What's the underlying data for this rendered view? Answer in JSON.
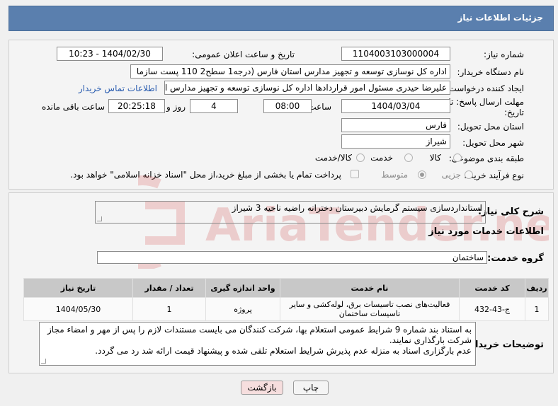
{
  "header": {
    "title": "جزئیات اطلاعات نیاز"
  },
  "fields": {
    "need_number_label": "شماره نیاز:",
    "need_number": "1104003103000004",
    "announce_label": "تاریخ و ساعت اعلان عمومی:",
    "announce_value": "1404/02/30 - 10:23",
    "buyer_label": "نام دستگاه خریدار:",
    "buyer_value": "اداره کل نوسازی   توسعه و تجهیز مدارس استان فارس (درجه1  سطح2  110 پست سازما",
    "creator_label": "ایجاد کننده درخواست:",
    "creator_value": "علیرضا حیدری مسئول امور قراردادها اداره کل نوسازی   توسعه و تجهیز مدارس ا",
    "contact_link": "اطلاعات تماس خریدار",
    "deadline_label": "مهلت ارسال پاسخ: تا",
    "deadline_label2": "تاریخ:",
    "deadline_date": "1404/03/04",
    "time_label": "ساعت",
    "deadline_time": "08:00",
    "days_value": "4",
    "days_label": "روز و",
    "remaining_time": "20:25:18",
    "remaining_label": "ساعت باقی مانده",
    "province_label": "استان محل تحویل:",
    "province_value": "فارس",
    "city_label": "شهر محل تحویل:",
    "city_value": "شیراز",
    "category_label": "طبقه بندی موضوعی:",
    "category_options": [
      "کالا",
      "خدمت",
      "کالا/خدمت"
    ],
    "process_label": "نوع فرآیند خرید :",
    "process_options": [
      "جزیی",
      "متوسط"
    ],
    "payment_note": "پرداخت تمام یا بخشی از مبلغ خرید،از محل \"اسناد خزانه اسلامی\" خواهد بود."
  },
  "summary": {
    "label": "شرح کلی نیاز:",
    "value": "استانداردسازی سیستم گرمایش دبیرستان دخترانه راضیه ناحیه 3 شیراز"
  },
  "services": {
    "heading": "اطلاعات خدمات مورد نیاز",
    "group_label": "گروه خدمت:",
    "group_value": "ساختمان",
    "columns": [
      "ردیف",
      "کد خدمت",
      "نام خدمت",
      "واحد اندازه گیری",
      "تعداد / مقدار",
      "تاریخ نیاز"
    ],
    "rows": [
      [
        "1",
        "ج-43-432",
        "فعالیت‌های نصب تاسیسات برق، لوله‌کشی و سایر تاسیسات ساختمان",
        "پروژه",
        "1",
        "1404/05/30"
      ]
    ]
  },
  "buyer_notes": {
    "label": "توضیحات خریدار:",
    "line1": "به استناد بند شماره 9 شرایط عمومی استعلام بها، شرکت کنندگان می بایست مستندات لازم را پس از مهر و امضاء مجاز",
    "line2": "شرکت بارگذاری نمایند.",
    "line3": "عدم بارگزاری اسناد به منزله عدم پذیرش شرایط استعلام تلقی شده و پیشنهاد قیمت ارائه شد رد می گردد."
  },
  "buttons": {
    "print": "چاپ",
    "back": "بازگشت"
  },
  "watermark": {
    "text": "AriaTender.neT"
  },
  "colors": {
    "header_bg": "#5a7fae",
    "link": "#2a5db0",
    "back_button_bg": "#f6dede"
  }
}
